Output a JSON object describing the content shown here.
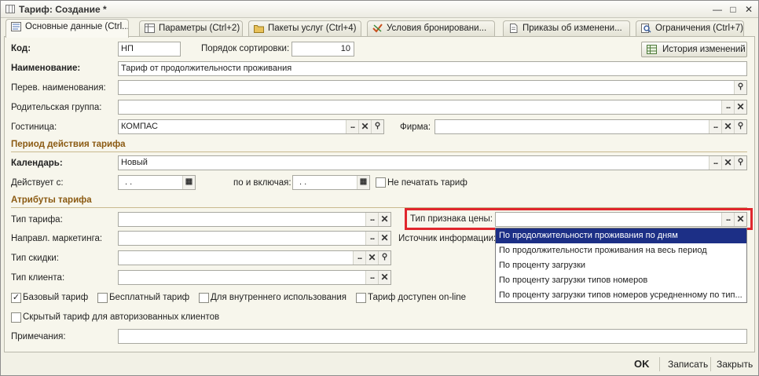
{
  "window": {
    "title": "Тариф: Создание *",
    "minimize_icon": "minimize-icon",
    "maximize_icon": "maximize-icon",
    "close_icon": "close-icon"
  },
  "tabs": [
    {
      "label": "Основные данные (Ctrl...",
      "icon": "form-icon"
    },
    {
      "label": "Параметры (Ctrl+2)",
      "icon": "table-icon"
    },
    {
      "label": "Пакеты услуг (Ctrl+4)",
      "icon": "folder-icon"
    },
    {
      "label": "Условия бронировани...",
      "icon": "conditions-icon"
    },
    {
      "label": "Приказы об изменени...",
      "icon": "document-icon"
    },
    {
      "label": "Ограничения (Ctrl+7)",
      "icon": "search-doc-icon"
    }
  ],
  "form": {
    "code_label": "Код:",
    "code_value": "НП",
    "sort_label": "Порядок сортировки:",
    "sort_value": "10",
    "history_button": "История изменений",
    "name_label": "Наименование:",
    "name_value": "Тариф от продолжительности проживания",
    "translation_label": "Перев. наименования:",
    "parent_label": "Родительская группа:",
    "hotel_label": "Гостиница:",
    "hotel_value": "КОМПАС",
    "company_label": "Фирма:",
    "period_section": "Период действия тарифа",
    "calendar_label": "Календарь:",
    "calendar_value": "Новый",
    "valid_from_label": "Действует с:",
    "valid_from_value": ". .",
    "valid_to_label": "по и включая:",
    "valid_to_value": ". .",
    "no_print_label": "Не печатать тариф",
    "attributes_section": "Атрибуты тарифа",
    "tariff_type_label": "Тип тарифа:",
    "marketing_label": "Направл. маркетинга:",
    "discount_type_label": "Тип скидки:",
    "client_type_label": "Тип клиента:",
    "price_sign_label": "Тип признака цены:",
    "price_sign_value": "",
    "info_source_label": "Источник информации:",
    "base_tariff_label": "Базовый тариф",
    "base_tariff_checked": true,
    "free_tariff_label": "Бесплатный тариф",
    "internal_label": "Для внутреннего использования",
    "online_label": "Тариф доступен on-line",
    "hidden_label": "Скрытый тариф для авторизованных клиентов",
    "notes_label": "Примечания:"
  },
  "dropdown": {
    "items": [
      "По продолжительности проживания по дням",
      "По продолжительности проживания на весь период",
      "По проценту загрузки",
      "По проценту загрузки типов номеров",
      "По проценту загрузки типов номеров усредненному по тип..."
    ],
    "selected_index": 0
  },
  "footer": {
    "ok_label": "OK",
    "save_label": "Записать",
    "close_label": "Закрыть"
  },
  "colors": {
    "highlight": "#e0262d",
    "section_title": "#8b5a12",
    "selected_item": "#1c2f86"
  }
}
